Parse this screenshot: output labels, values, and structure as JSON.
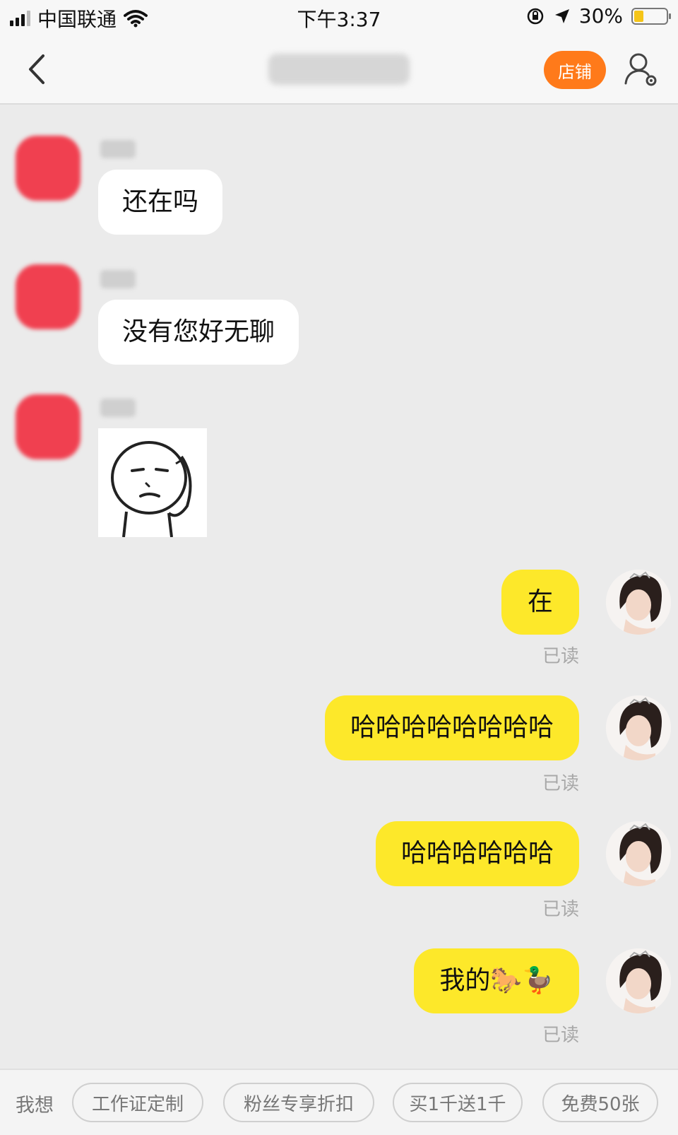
{
  "status_bar": {
    "carrier": "中国联通",
    "time": "下午3:37",
    "battery_percent": "30%",
    "battery_level": 0.3,
    "icons": [
      "signal-icon",
      "wifi-icon",
      "orientation-lock-icon",
      "location-arrow-icon",
      "battery-icon"
    ]
  },
  "nav": {
    "title": "",
    "shop_label": "店铺",
    "icons": [
      "back-chevron-icon",
      "user-settings-icon"
    ]
  },
  "messages_in": [
    {
      "text": "还在吗",
      "type": "text"
    },
    {
      "text": "没有您好无聊",
      "type": "text"
    },
    {
      "type": "sticker",
      "icon": "meme-face-sticker"
    }
  ],
  "messages_out": [
    {
      "text": "在",
      "status": "已读"
    },
    {
      "text": "哈哈哈哈哈哈哈哈",
      "status": "已读"
    },
    {
      "text": "哈哈哈哈哈哈",
      "status": "已读"
    },
    {
      "text": "我的🐎🦆",
      "status": "已读"
    }
  ],
  "quick_bar": {
    "label": "我想",
    "chips": [
      "工作证定制",
      "粉丝专享折扣",
      "买1千送1千",
      "免费50张"
    ]
  },
  "colors": {
    "background": "#ebebeb",
    "incoming_bubble": "#ffffff",
    "outgoing_bubble": "#fde82a",
    "shop_button": "#ff7a1a",
    "avatar_blur": "#f04050",
    "read_text": "#a8a8a8"
  }
}
